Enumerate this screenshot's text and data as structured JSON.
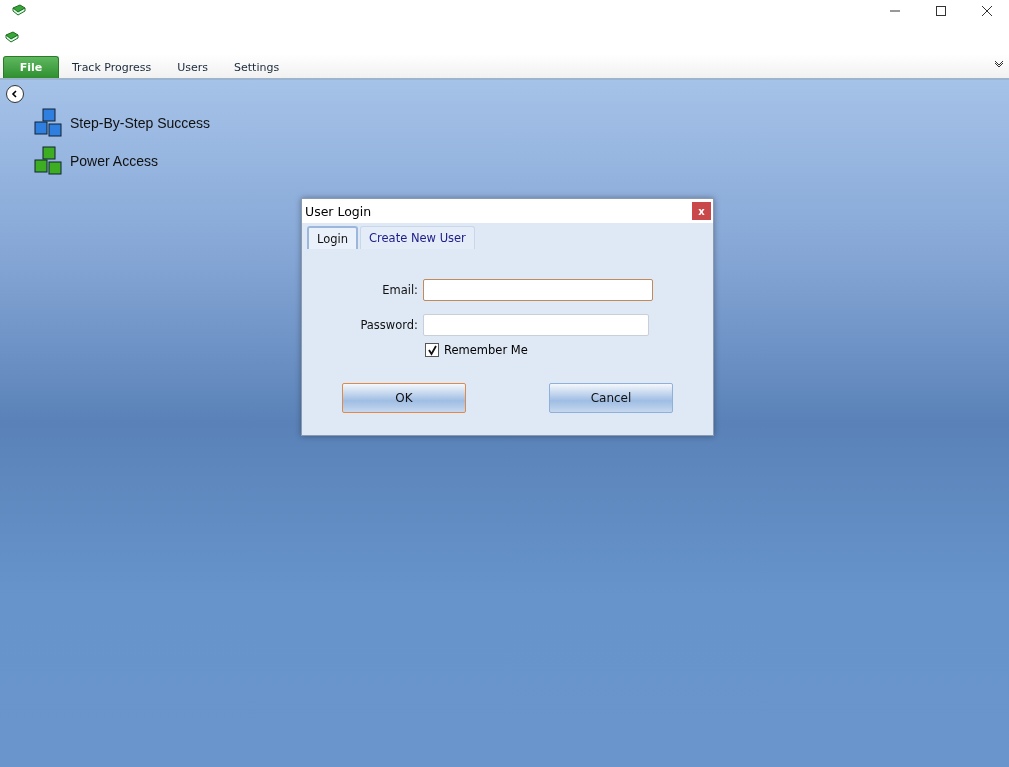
{
  "menu_tabs": [
    {
      "label": "File",
      "selected": true
    },
    {
      "label": "Track Progress",
      "selected": false
    },
    {
      "label": "Users",
      "selected": false
    },
    {
      "label": "Settings",
      "selected": false
    }
  ],
  "nav_items": [
    {
      "label": "Step-By-Step Success",
      "color": "#2f7fe0"
    },
    {
      "label": "Power Access",
      "color": "#3dae22"
    }
  ],
  "dialog": {
    "title": "User Login",
    "close_label": "x",
    "tabs": [
      {
        "label": "Login",
        "selected": true
      },
      {
        "label": "Create New User",
        "selected": false
      }
    ],
    "fields": [
      {
        "label": "Email:",
        "focused": true
      },
      {
        "label": "Password:",
        "focused": false
      }
    ],
    "remember": {
      "label": "Remember Me",
      "checked": true
    },
    "buttons": [
      {
        "label": "OK",
        "focused": true
      },
      {
        "label": "Cancel",
        "focused": false
      }
    ]
  }
}
